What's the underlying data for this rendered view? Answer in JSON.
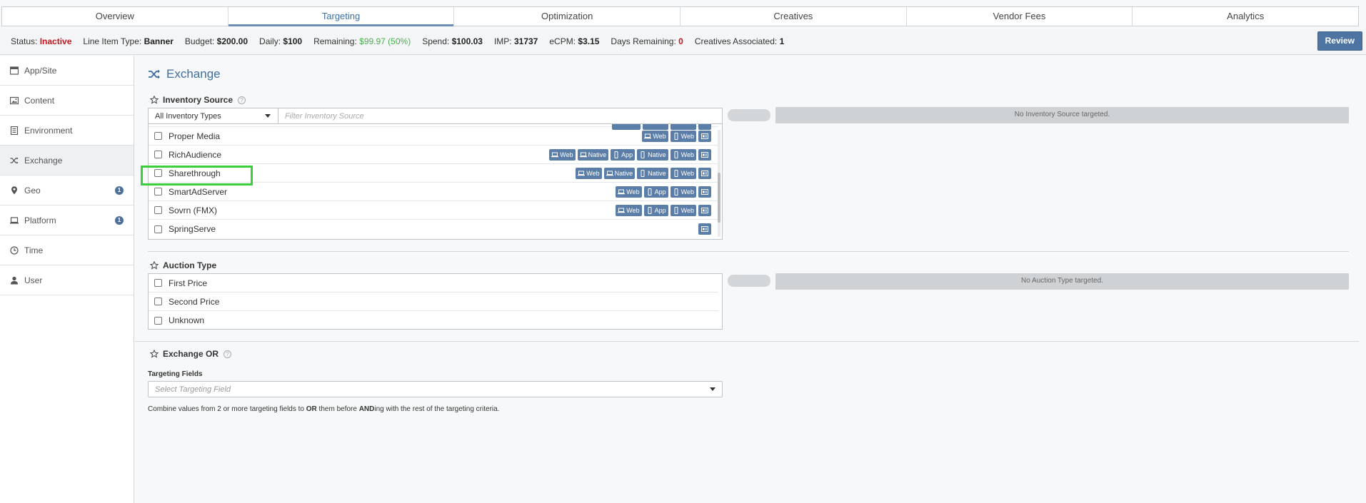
{
  "tabs": [
    {
      "label": "Overview"
    },
    {
      "label": "Targeting"
    },
    {
      "label": "Optimization"
    },
    {
      "label": "Creatives"
    },
    {
      "label": "Vendor Fees"
    },
    {
      "label": "Analytics"
    }
  ],
  "status": {
    "status_label": "Status:",
    "status_value": "Inactive",
    "type_label": "Line Item Type:",
    "type_value": "Banner",
    "budget_label": "Budget:",
    "budget_value": "$200.00",
    "daily_label": "Daily:",
    "daily_value": "$100",
    "remaining_label": "Remaining:",
    "remaining_value": "$99.97 (50%)",
    "spend_label": "Spend:",
    "spend_value": "$100.03",
    "imp_label": "IMP:",
    "imp_value": "31737",
    "ecpm_label": "eCPM:",
    "ecpm_value": "$3.15",
    "days_label": "Days Remaining:",
    "days_value": "0",
    "creatives_label": "Creatives Associated:",
    "creatives_value": "1",
    "review_button": "Review"
  },
  "sidebar": {
    "items": [
      {
        "label": "App/Site",
        "icon": "window-icon"
      },
      {
        "label": "Content",
        "icon": "image-icon"
      },
      {
        "label": "Environment",
        "icon": "document-icon"
      },
      {
        "label": "Exchange",
        "icon": "shuffle-icon"
      },
      {
        "label": "Geo",
        "icon": "map-pin-icon",
        "badge": "1"
      },
      {
        "label": "Platform",
        "icon": "laptop-icon",
        "badge": "1"
      },
      {
        "label": "Time",
        "icon": "clock-icon"
      },
      {
        "label": "User",
        "icon": "user-icon"
      }
    ]
  },
  "main": {
    "title": "Exchange",
    "inventory": {
      "label": "Inventory Source",
      "dropdown_value": "All Inventory Types",
      "filter_placeholder": "Filter Inventory Source",
      "rows": [
        {
          "name": "Proper Media",
          "pills": [
            "Web",
            "Web"
          ]
        },
        {
          "name": "RichAudience",
          "pills": [
            "Web",
            "Native",
            "App",
            "Native",
            "Web"
          ]
        },
        {
          "name": "Sharethrough",
          "pills": [
            "Web",
            "Native",
            "Native",
            "Web"
          ]
        },
        {
          "name": "SmartAdServer",
          "pills": [
            "Web",
            "App",
            "Web"
          ]
        },
        {
          "name": "Sovrn (FMX)",
          "pills": [
            "Web",
            "App",
            "Web"
          ]
        },
        {
          "name": "SpringServe",
          "pills": []
        }
      ],
      "empty_message": "No Inventory Source targeted."
    },
    "auction": {
      "label": "Auction Type",
      "rows": [
        {
          "name": "First Price"
        },
        {
          "name": "Second Price"
        },
        {
          "name": "Unknown"
        }
      ],
      "empty_message": "No Auction Type targeted."
    },
    "exchange_or": {
      "label": "Exchange OR",
      "fields_label": "Targeting Fields",
      "select_placeholder": "Select Targeting Field",
      "hint_a": "Combine values from 2 or more targeting fields to ",
      "hint_or": "OR",
      "hint_b": " them before ",
      "hint_and": "AND",
      "hint_c": "ing with the rest of the targeting criteria."
    }
  },
  "colors": {
    "accent": "#3f6fa0",
    "pill": "#5b7ea8",
    "danger": "#c4161c",
    "success": "#4caf50",
    "highlight": "#3ccf3c"
  }
}
